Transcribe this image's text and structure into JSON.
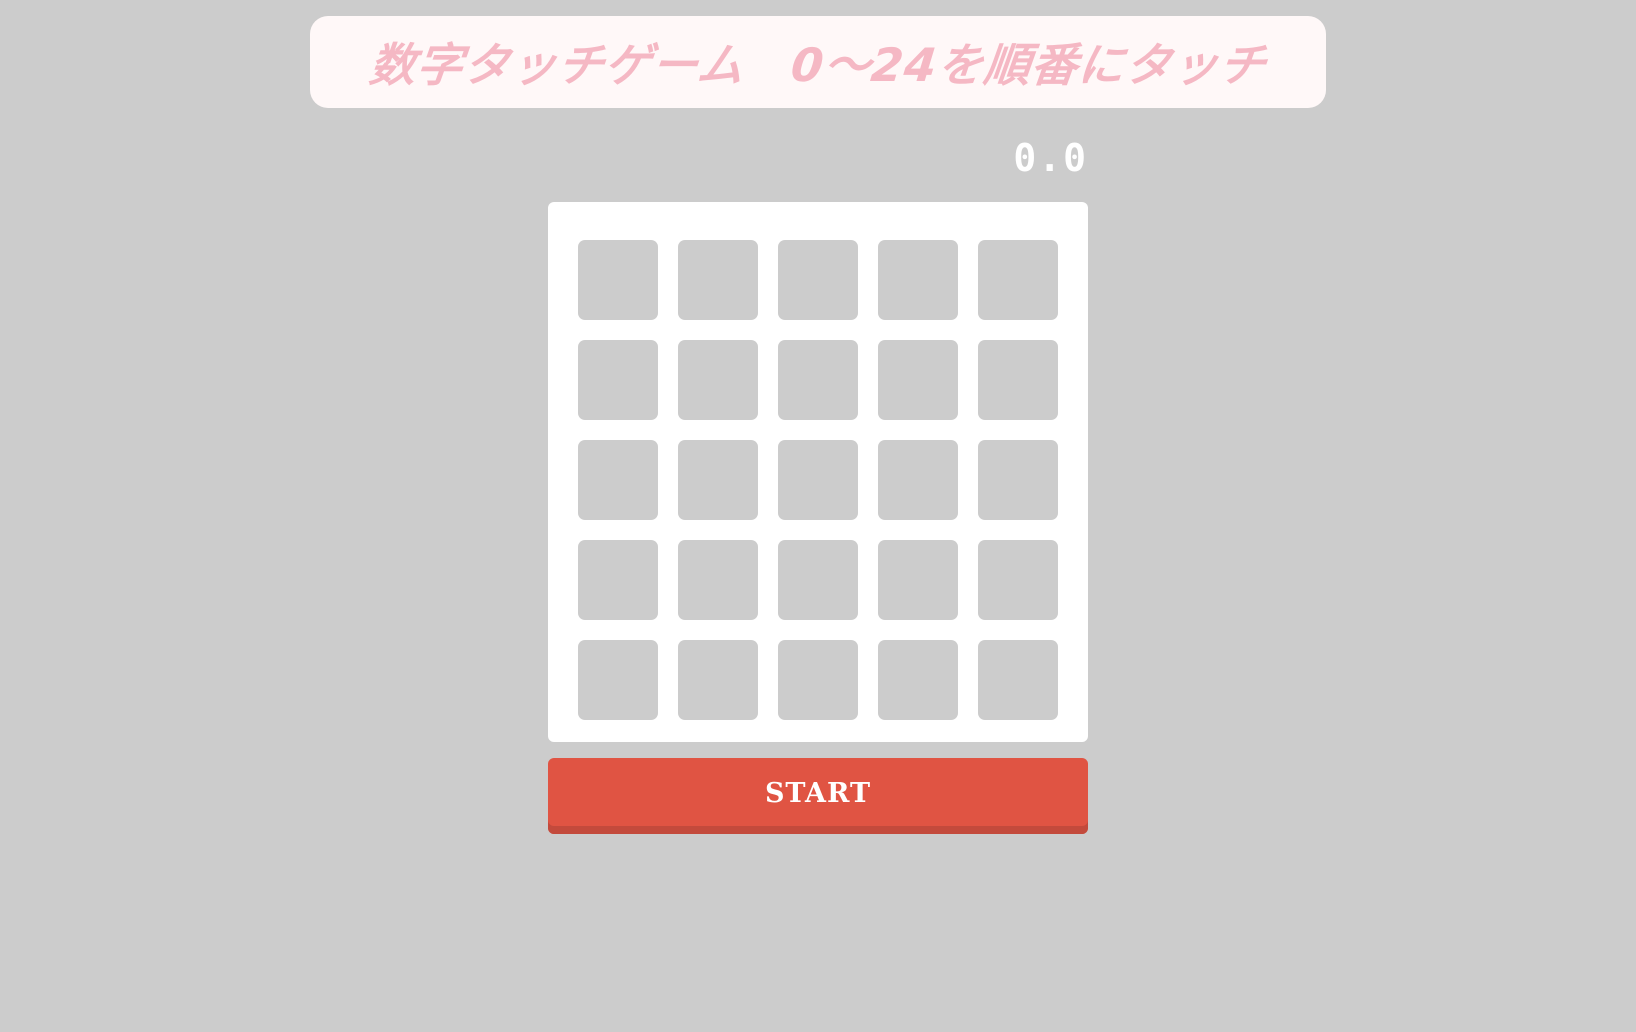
{
  "header": {
    "title": "数字タッチゲーム　0〜24を順番にタッチ"
  },
  "timer": {
    "value": "0.0"
  },
  "board": {
    "rows": 5,
    "columns": 5,
    "cells": [
      "",
      "",
      "",
      "",
      "",
      "",
      "",
      "",
      "",
      "",
      "",
      "",
      "",
      "",
      "",
      "",
      "",
      "",
      "",
      "",
      "",
      "",
      "",
      "",
      ""
    ]
  },
  "controls": {
    "start_label": "START"
  },
  "colors": {
    "background": "#cccccc",
    "title": "#f5b8c4",
    "board": "#ffffff",
    "cell": "#cccccc",
    "start_button": "#e05443"
  }
}
